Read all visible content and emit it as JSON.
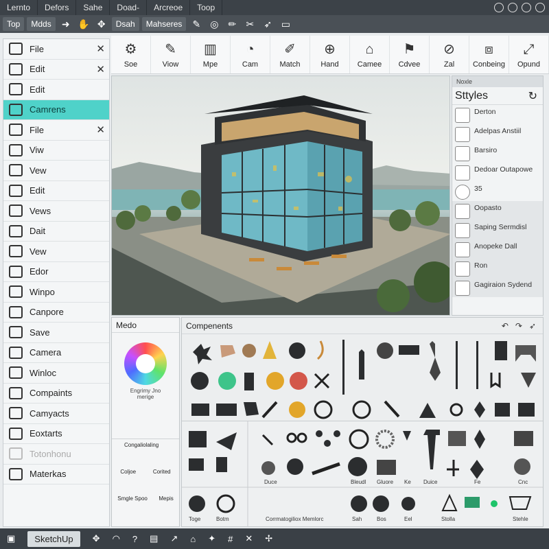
{
  "menubar": {
    "items": [
      "Lernto",
      "Defors",
      "Sahe",
      "Doad-",
      "Arcreoe",
      "Toop"
    ]
  },
  "toolbar2": {
    "buttons": [
      "Top",
      "Mdds"
    ],
    "middle_labels": [
      "Dsah",
      "Mahseres"
    ]
  },
  "sidebar": {
    "items": [
      {
        "label": "File",
        "mark": "✕"
      },
      {
        "label": "Edit",
        "mark": "✕"
      },
      {
        "label": "Edit",
        "mark": ""
      },
      {
        "label": "Camrens",
        "mark": "",
        "active": true
      },
      {
        "label": "File",
        "mark": "✕"
      },
      {
        "label": "Viw",
        "mark": ""
      },
      {
        "label": "Vew",
        "mark": ""
      },
      {
        "label": "Edit",
        "mark": ""
      },
      {
        "label": "Vews",
        "mark": ""
      },
      {
        "label": "Dait",
        "mark": ""
      },
      {
        "label": "Vew",
        "mark": ""
      },
      {
        "label": "Edor",
        "mark": ""
      },
      {
        "label": "Winpo",
        "mark": ""
      },
      {
        "label": "Canpore",
        "mark": ""
      },
      {
        "label": "Save",
        "mark": ""
      },
      {
        "label": "Camera",
        "mark": ""
      },
      {
        "label": "Winloc",
        "mark": ""
      },
      {
        "label": "Compaints",
        "mark": ""
      },
      {
        "label": "Camyacts",
        "mark": ""
      },
      {
        "label": "Eoxtarts",
        "mark": ""
      },
      {
        "label": "Totonhonu",
        "mark": ""
      },
      {
        "label": "Materkas",
        "mark": ""
      }
    ]
  },
  "ribbon": {
    "tools": [
      {
        "label": "Soe",
        "icon": "gear-icon"
      },
      {
        "label": "Viow",
        "icon": "pencil-icon"
      },
      {
        "label": "Mpe",
        "icon": "paint-bucket-icon"
      },
      {
        "label": "Cam",
        "icon": "camera-icon"
      },
      {
        "label": "Match",
        "icon": "match-icon"
      },
      {
        "label": "Hand",
        "icon": "hand-icon"
      },
      {
        "label": "Camee",
        "icon": "house-icon"
      },
      {
        "label": "Cdvee",
        "icon": "flag-icon"
      },
      {
        "label": "Zal",
        "icon": "zoom-icon"
      },
      {
        "label": "Conbeing",
        "icon": "box-icon"
      },
      {
        "label": "Opund",
        "icon": "expand-icon"
      }
    ]
  },
  "styles": {
    "header": "Noxle",
    "title": "Sttyles",
    "rows": [
      {
        "text": "Derton"
      },
      {
        "text": "Adelpas Anstiil"
      },
      {
        "text": "Barsiro"
      },
      {
        "text": "Dedoar Outapowe"
      },
      {
        "text": "35"
      },
      {
        "text": "Oopasto"
      },
      {
        "text": "Saping Sermdisl"
      },
      {
        "text": "Anopeke Dall"
      },
      {
        "text": "Ron"
      },
      {
        "text": "Gagiraion Sydend"
      }
    ]
  },
  "medo": {
    "title": "Medo",
    "wheel_caption": "Engrimy Jno merige",
    "captions": [
      "Congaliolaling",
      "Coljoe",
      "Corited",
      "Smgle Spoo",
      "Mepis"
    ]
  },
  "components": {
    "title": "Compenents",
    "captions": [
      "Toge",
      "Botm",
      "Corrmatogiliox Memlorc",
      "Duce",
      "Bleudl",
      "Gluore",
      "Ke",
      "Duice",
      "Fe",
      "Sah",
      "Bos",
      "Eel",
      "Stolla",
      "Stehle",
      "Cnc"
    ]
  },
  "statusbar": {
    "brand": "SketchUp"
  },
  "colors": {
    "accent": "#4fd2c9",
    "menubar": "#3c4248",
    "toolbar": "#4a5056",
    "statusbar": "#3a4046"
  }
}
